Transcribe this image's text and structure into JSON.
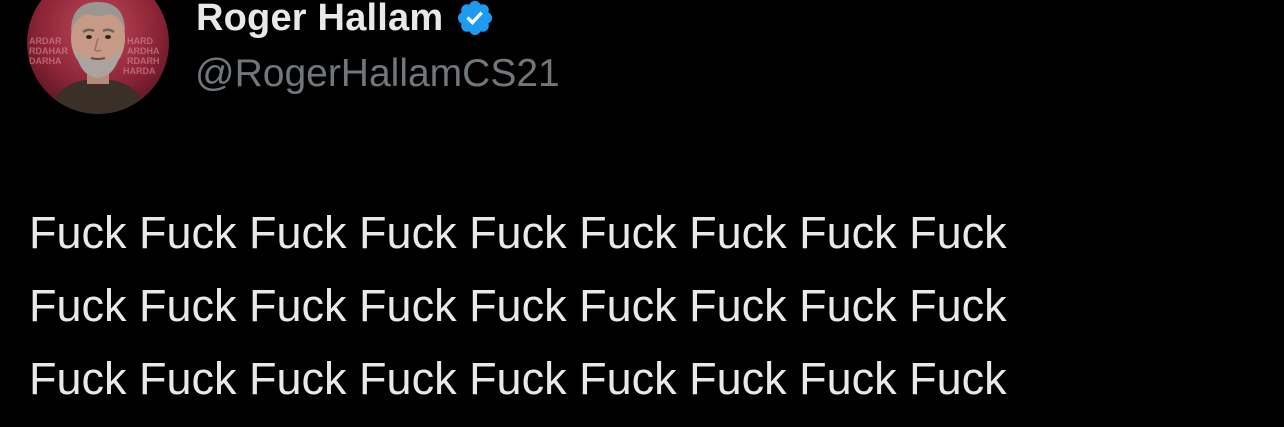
{
  "author": {
    "display_name": "Roger Hallam",
    "handle": "@RogerHallamCS21",
    "verified": true,
    "verified_icon": "verified-badge-icon"
  },
  "tweet": {
    "lines": [
      "Fuck Fuck Fuck Fuck Fuck Fuck Fuck Fuck Fuck",
      "Fuck Fuck Fuck Fuck Fuck Fuck Fuck Fuck Fuck",
      "Fuck Fuck Fuck Fuck Fuck Fuck Fuck Fuck Fuck"
    ]
  },
  "colors": {
    "background": "#000000",
    "primary_text": "#e7e9ea",
    "secondary_text": "#71767b",
    "verified_blue": "#1d9bf0"
  }
}
